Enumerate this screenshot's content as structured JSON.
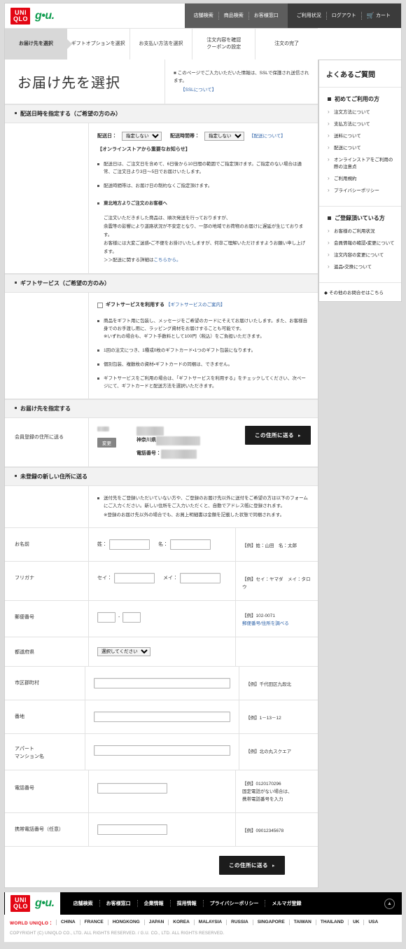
{
  "header": {
    "brand_uniqlo_line1": "UNI",
    "brand_uniqlo_line2": "QLO",
    "brand_gu": "g•u.",
    "nav_group1": [
      {
        "label": "店舗検索",
        "name": "store-search"
      },
      {
        "label": "商品検索",
        "name": "product-search"
      },
      {
        "label": "お客様窓口",
        "name": "customer-support"
      }
    ],
    "nav_group2": [
      {
        "label": "ご利用状況",
        "name": "usage-status"
      },
      {
        "label": "ログアウト",
        "name": "logout"
      }
    ],
    "cart_label": "カート"
  },
  "steps": [
    {
      "label": "お届け先を選択",
      "active": true
    },
    {
      "label": "ギフトオプションを選択",
      "active": false
    },
    {
      "label": "お支払い方法を選択",
      "active": false
    },
    {
      "label": "注文内容を確認\nクーポンの設定",
      "active": false
    },
    {
      "label": "注文の完了",
      "active": false
    }
  ],
  "main": {
    "page_title": "お届け先を選択",
    "ssl_note": "このページでご入力いただいた情報は、SSLで保護され送信されます。",
    "ssl_link": "【SSLについて】",
    "delivery": {
      "section_title": "配送日時を指定する（ご希望の方のみ）",
      "date_label": "配送日：",
      "date_value": "指定しない",
      "time_label": "配送時間帯：",
      "time_value": "指定しない",
      "delivery_link": "【配送について】",
      "notice_head": "【オンラインストアから重要なお知らせ】",
      "notes": [
        "配送日は、ご注文日を含めて、6日後から10日間の範囲でご指定頂けます。ご指定のない場合は通常、ご注文日より3日～5日でお届けいたします。",
        "配送時間帯は、お届け日の制約なくご指定頂けます。"
      ],
      "tohoku_head": "東北地方よりご注文のお客様へ",
      "tohoku_lines": [
        "ご注文いただきました商品は、順次発送を行っておりますが、",
        "余震等の影響により道路状況が不安定となり、一部の地域でお荷物のお届けに遅延が生じております。",
        "お客様には大変ご迷惑・ご不便をお掛けいたしますが、何卒ご理解いただけますようお願い申し上げます。"
      ],
      "tohoku_link_prefix": "＞＞配送に関する詳細は",
      "tohoku_link": "こちらから。"
    },
    "gift": {
      "section_title": "ギフトサービス（ご希望の方のみ）",
      "checkbox_label": "ギフトサービスを利用する",
      "checkbox_link": "【ギフトサービスのご案内】",
      "notes": [
        "商品をギフト用に包装し、メッセージをご希望のカードにそえてお届けいたします。また、お客様自身でのお手渡し用に、ラッピング資材をお届けすることも可能です。\n※いずれの場合も、ギフト手数料として100円（税込）をご負担いただきます。",
        "1回の注文につき、1種或0枚のギフトカード・1つのギフト包装になります。",
        "個別包装、複数枚の資材・ギフトカードの同梱は、できません。",
        "ギフトサービスをご利用の場合は、「ギフトサービスを利用する」をチェックしてください、次ページにて、ギフトカードと配送方法を選択いただきます。"
      ]
    },
    "registered": {
      "section_title": "お届け先を指定する",
      "row_label": "会員登録の住所に送る",
      "name_masked": "■■■■",
      "change_button": "変更",
      "zip_masked": "〒■■■-■■■■",
      "pref_prefix": "神奈川県",
      "addr_masked": "■■■■■■■■■■■■■■■",
      "tel_label": "電話番号：",
      "tel_masked": "■■■-■■■■-■■■■",
      "send_button": "この住所に送る"
    },
    "newaddr": {
      "section_title": "未登録の新しい住所に送る",
      "intro_lines": [
        "送付先をご登録いただいていない方や、ご登録のお届け先以外に送付をご希望の方は以下のフォームにご入力ください。新しい住所をご入力いただくと、自動でアドレス帳に登録されます。",
        "※登録のお届け先以外の場合でも、お買上明細書は金額を記載した状態で同梱されます。"
      ],
      "fields": [
        {
          "label": "お名前",
          "type": "name",
          "sub1": "姓：",
          "val1": "",
          "sub2": "名：",
          "val2": "",
          "hint": "【例】姓：山田　名：太郎"
        },
        {
          "label": "フリガナ",
          "type": "name",
          "sub1": "セイ：",
          "val1": "",
          "sub2": "メイ：",
          "val2": "",
          "hint": "【例】セイ：ヤマダ　メイ：タロウ"
        },
        {
          "label": "郵便番号",
          "type": "zip",
          "hint": "【例】102-0071",
          "hint_link": "郵便番号/住所を調べる"
        },
        {
          "label": "都道府県",
          "type": "select",
          "select_value": "選択してください",
          "hint": ""
        },
        {
          "label": "市区郡町村",
          "type": "text",
          "hint": "【例】千代田区九段北"
        },
        {
          "label": "番地",
          "type": "text",
          "hint": "【例】1－13－12"
        },
        {
          "label": "アパート\nマンション名",
          "type": "text",
          "hint": "【例】北の丸スクエア"
        },
        {
          "label": "電話番号",
          "type": "text-mid",
          "hint": "【例】0120170296\n固定電話がない場合は、\n携帯電話番号を入力"
        },
        {
          "label": "携帯電話番号（任意）",
          "type": "text-mid",
          "hint": "【例】09012345678"
        }
      ],
      "send_button": "この住所に送る"
    }
  },
  "sidebar": {
    "title": "よくあるご質問",
    "groups": [
      {
        "head": "初めてご利用の方",
        "items": [
          "注文方法について",
          "支払方法について",
          "送料について",
          "配送について",
          "オンラインストアをご利用の際の注意点",
          "ご利用規約",
          "プライバシーポリシー"
        ]
      },
      {
        "head": "ご登録頂いている方",
        "items": [
          "お客様のご利用状況",
          "会員情報の確認・変更について",
          "注文内容の変更について",
          "返品・交換について"
        ]
      }
    ],
    "footer_link": "その他のお問合せはこちら"
  },
  "footer": {
    "nav": [
      "店舗検索",
      "お客様窓口",
      "企業情報",
      "採用情報",
      "プライバシーポリシー",
      "メルマガ登録"
    ],
    "world_label": "WORLD UNIQLO：",
    "countries": [
      "CHINA",
      "FRANCE",
      "HONGKONG",
      "JAPAN",
      "KOREA",
      "MALAYSIA",
      "RUSSIA",
      "SINGAPORE",
      "TAIWAN",
      "THAILAND",
      "UK",
      "USA"
    ],
    "copyright": "COPYRIGHT (C) UNIQLO CO., LTD. ALL RIGHTS RESERVED. / G.U. CO., LTD. ALL RIGHTS RESERVED.",
    "top_icon": "▲"
  },
  "colors": {
    "uniqlo_red": "#e30613",
    "gu_green": "#0f9c4f",
    "link_blue": "#3b74bd",
    "dark_button": "#1c1c1c",
    "section_bg": "#f2f2f2"
  }
}
